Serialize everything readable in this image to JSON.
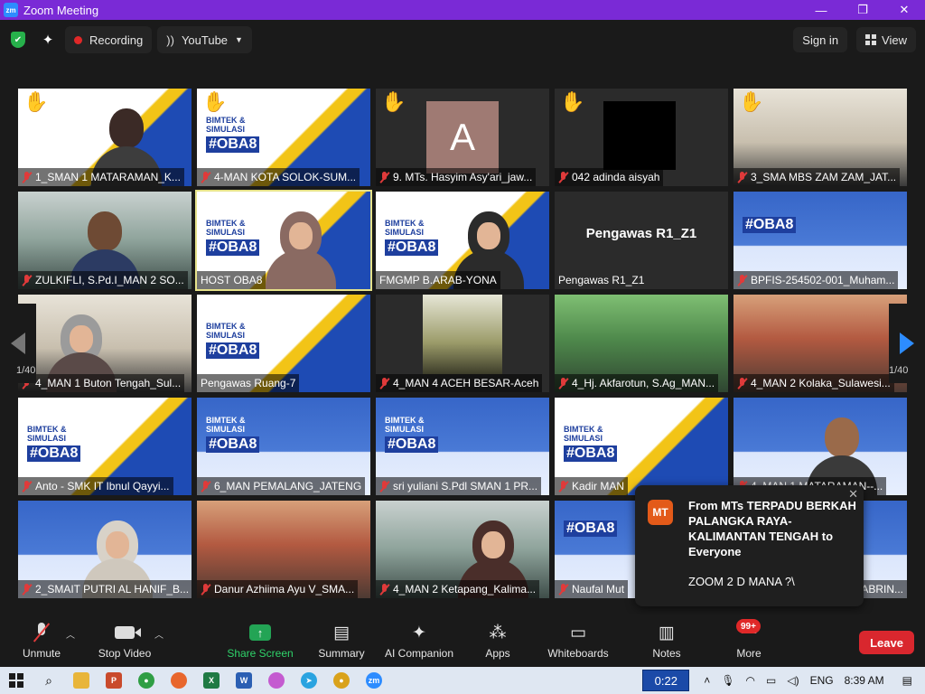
{
  "window": {
    "title": "Zoom Meeting",
    "app_logo": "zm",
    "minimize": "—",
    "maximize": "❐",
    "close": "✕"
  },
  "topbar": {
    "recording_label": "Recording",
    "stream_label": "YouTube",
    "sign_in_label": "Sign in",
    "view_label": "View"
  },
  "gallery": {
    "page_left": "1/40",
    "page_right": "1/40",
    "tiles": [
      {
        "label": "1_SMAN 1 MATARAMAN_K..."
      },
      {
        "label": "4-MAN KOTA SOLOK-SUM..."
      },
      {
        "label": "9. MTs. Hasyim Asy'ari_jaw...",
        "avatar": "A"
      },
      {
        "label": "042 adinda aisyah"
      },
      {
        "label": "3_SMA MBS ZAM ZAM_JAT..."
      },
      {
        "label": "ZULKIFLI, S.Pd.I_MAN 2 SO..."
      },
      {
        "label": "HOST OBA8"
      },
      {
        "label": "FMGMP B.ARAB-YONA"
      },
      {
        "label": "Pengawas R1_Z1",
        "center_name": "Pengawas R1_Z1"
      },
      {
        "label": "BPFIS-254502-001_Muham..."
      },
      {
        "label": "4_MAN 1 Buton Tengah_Sul..."
      },
      {
        "label": "Pengawas Ruang-7"
      },
      {
        "label": "4_MAN 4 ACEH BESAR-Aceh"
      },
      {
        "label": "4_Hj. Akfarotun, S.Ag_MAN..."
      },
      {
        "label": "4_MAN 2 Kolaka_Sulawesi..."
      },
      {
        "label": "Anto - SMK IT Ibnul Qayyi..."
      },
      {
        "label": "6_MAN PEMALANG_JATENG"
      },
      {
        "label": "sri yuliani S.Pdl SMAN 1 PR..."
      },
      {
        "label": "Kadir MAN"
      },
      {
        "label": "4_MAN 1 MATARAMAN--..."
      },
      {
        "label": "2_SMAIT PUTRI AL HANIF_B..."
      },
      {
        "label": "Danur Azhiima Ayu V_SMA..."
      },
      {
        "label": "4_MAN 2 Ketapang_Kalima..."
      },
      {
        "label": "Naufal Mut"
      },
      {
        "label": "ABRIN..."
      }
    ],
    "bimtek": {
      "line1": "BIMTEK &",
      "line2": "SIMULASI",
      "big": "#OBA8"
    }
  },
  "chat": {
    "avatar": "MT",
    "from": "From MTs TERPADU BERKAH PALANGKA RAYA-KALIMANTAN TENGAH to Everyone",
    "message": "ZOOM 2 D MANA ?\\",
    "close": "✕"
  },
  "toolbar": {
    "unmute": "Unmute",
    "stop_video": "Stop Video",
    "share_screen": "Share Screen",
    "summary": "Summary",
    "ai_companion": "AI Companion",
    "apps": "Apps",
    "whiteboards": "Whiteboards",
    "notes": "Notes",
    "more": "More",
    "more_badge": "99+",
    "leave": "Leave"
  },
  "taskbar": {
    "timer": "0:22",
    "lang": "ENG",
    "time": "8:39 AM"
  },
  "colors": {
    "title_bar": "#7a2ad6",
    "leave": "#d9272e",
    "share": "#23a455",
    "recording_dot": "#e02828"
  }
}
